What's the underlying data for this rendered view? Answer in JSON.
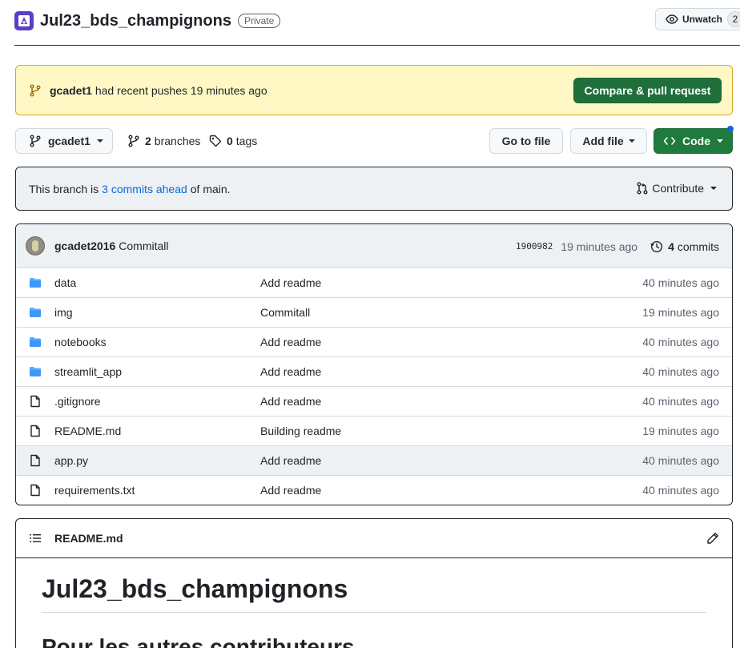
{
  "repo": {
    "name": "Jul23_bds_champignons",
    "visibility": "Private",
    "unwatch_label": "Unwatch",
    "watchers": "2"
  },
  "banner": {
    "user": "gcadet1",
    "text": "had recent pushes 19 minutes ago",
    "button": "Compare & pull request"
  },
  "toolbar": {
    "branch": "gcadet1",
    "branches_count": "2",
    "branches_label": "branches",
    "tags_count": "0",
    "tags_label": "tags",
    "go_to_file": "Go to file",
    "add_file": "Add file",
    "code": "Code"
  },
  "ahead": {
    "prefix": "This branch is",
    "link": "3 commits ahead",
    "suffix": "of main.",
    "contribute": "Contribute"
  },
  "last_commit": {
    "author": "gcadet2016",
    "message": "Commitall",
    "sha": "1900982",
    "time": "19 minutes ago",
    "commits_count": "4",
    "commits_label": "commits"
  },
  "files": [
    {
      "type": "folder",
      "name": "data",
      "message": "Add readme",
      "time": "40 minutes ago"
    },
    {
      "type": "folder",
      "name": "img",
      "message": "Commitall",
      "time": "19 minutes ago"
    },
    {
      "type": "folder",
      "name": "notebooks",
      "message": "Add readme",
      "time": "40 minutes ago"
    },
    {
      "type": "folder",
      "name": "streamlit_app",
      "message": "Add readme",
      "time": "40 minutes ago"
    },
    {
      "type": "file",
      "name": ".gitignore",
      "message": "Add readme",
      "time": "40 minutes ago"
    },
    {
      "type": "file",
      "name": "README.md",
      "message": "Building readme",
      "time": "19 minutes ago"
    },
    {
      "type": "file",
      "name": "app.py",
      "message": "Add readme",
      "time": "40 minutes ago"
    },
    {
      "type": "file",
      "name": "requirements.txt",
      "message": "Add readme",
      "time": "40 minutes ago"
    }
  ],
  "readme": {
    "filename": "README.md",
    "h1": "Jul23_bds_champignons",
    "h2": "Pour les autres contributeurs"
  },
  "colors": {
    "accent_green": "#1f6f3b",
    "link_blue": "#0969da",
    "folder_blue": "#54aeff",
    "banner_yellow": "#fff8c5"
  }
}
